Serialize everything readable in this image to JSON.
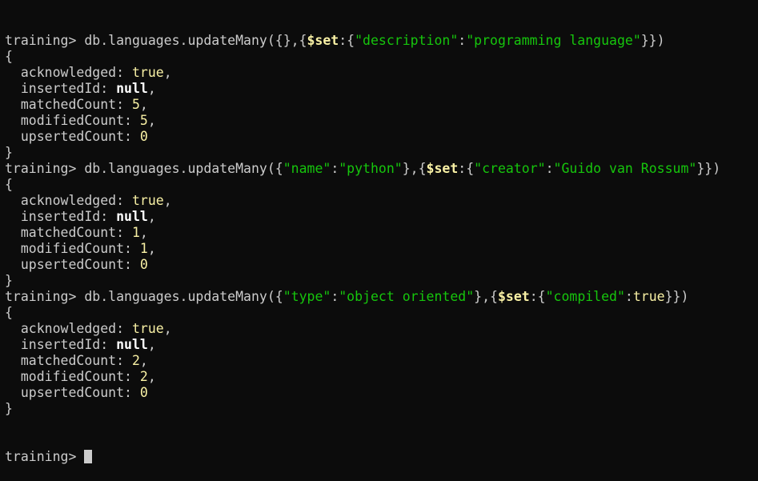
{
  "terminal": {
    "lines": [
      [
        {
          "t": "training> ",
          "c": "default"
        },
        {
          "t": "db.languages.updateMany({},{",
          "c": "default"
        },
        {
          "t": "$set",
          "c": "op"
        },
        {
          "t": ":{",
          "c": "default"
        },
        {
          "t": "\"description\"",
          "c": "string"
        },
        {
          "t": ":",
          "c": "default"
        },
        {
          "t": "\"programming language\"",
          "c": "string"
        },
        {
          "t": "}})",
          "c": "default"
        }
      ],
      [
        {
          "t": "{",
          "c": "default"
        }
      ],
      [
        {
          "t": "  acknowledged: ",
          "c": "default"
        },
        {
          "t": "true",
          "c": "bool"
        },
        {
          "t": ",",
          "c": "default"
        }
      ],
      [
        {
          "t": "  insertedId: ",
          "c": "default"
        },
        {
          "t": "null",
          "c": "null"
        },
        {
          "t": ",",
          "c": "default"
        }
      ],
      [
        {
          "t": "  matchedCount: ",
          "c": "default"
        },
        {
          "t": "5",
          "c": "num"
        },
        {
          "t": ",",
          "c": "default"
        }
      ],
      [
        {
          "t": "  modifiedCount: ",
          "c": "default"
        },
        {
          "t": "5",
          "c": "num"
        },
        {
          "t": ",",
          "c": "default"
        }
      ],
      [
        {
          "t": "  upsertedCount: ",
          "c": "default"
        },
        {
          "t": "0",
          "c": "num"
        }
      ],
      [
        {
          "t": "}",
          "c": "default"
        }
      ],
      [
        {
          "t": "training> ",
          "c": "default"
        },
        {
          "t": "db.languages.updateMany({",
          "c": "default"
        },
        {
          "t": "\"name\"",
          "c": "string"
        },
        {
          "t": ":",
          "c": "default"
        },
        {
          "t": "\"python\"",
          "c": "string"
        },
        {
          "t": "},{",
          "c": "default"
        },
        {
          "t": "$set",
          "c": "op"
        },
        {
          "t": ":{",
          "c": "default"
        },
        {
          "t": "\"creator\"",
          "c": "string"
        },
        {
          "t": ":",
          "c": "default"
        },
        {
          "t": "\"Guido van Rossum\"",
          "c": "string"
        },
        {
          "t": "}})",
          "c": "default"
        }
      ],
      [
        {
          "t": "{",
          "c": "default"
        }
      ],
      [
        {
          "t": "  acknowledged: ",
          "c": "default"
        },
        {
          "t": "true",
          "c": "bool"
        },
        {
          "t": ",",
          "c": "default"
        }
      ],
      [
        {
          "t": "  insertedId: ",
          "c": "default"
        },
        {
          "t": "null",
          "c": "null"
        },
        {
          "t": ",",
          "c": "default"
        }
      ],
      [
        {
          "t": "  matchedCount: ",
          "c": "default"
        },
        {
          "t": "1",
          "c": "num"
        },
        {
          "t": ",",
          "c": "default"
        }
      ],
      [
        {
          "t": "  modifiedCount: ",
          "c": "default"
        },
        {
          "t": "1",
          "c": "num"
        },
        {
          "t": ",",
          "c": "default"
        }
      ],
      [
        {
          "t": "  upsertedCount: ",
          "c": "default"
        },
        {
          "t": "0",
          "c": "num"
        }
      ],
      [
        {
          "t": "}",
          "c": "default"
        }
      ],
      [
        {
          "t": "training> ",
          "c": "default"
        },
        {
          "t": "db.languages.updateMany({",
          "c": "default"
        },
        {
          "t": "\"type\"",
          "c": "string"
        },
        {
          "t": ":",
          "c": "default"
        },
        {
          "t": "\"object oriented\"",
          "c": "string"
        },
        {
          "t": "},{",
          "c": "default"
        },
        {
          "t": "$set",
          "c": "op"
        },
        {
          "t": ":{",
          "c": "default"
        },
        {
          "t": "\"compiled\"",
          "c": "string"
        },
        {
          "t": ":",
          "c": "default"
        },
        {
          "t": "true",
          "c": "bool"
        },
        {
          "t": "}})",
          "c": "default"
        }
      ],
      [
        {
          "t": "{",
          "c": "default"
        }
      ],
      [
        {
          "t": "  acknowledged: ",
          "c": "default"
        },
        {
          "t": "true",
          "c": "bool"
        },
        {
          "t": ",",
          "c": "default"
        }
      ],
      [
        {
          "t": "  insertedId: ",
          "c": "default"
        },
        {
          "t": "null",
          "c": "null"
        },
        {
          "t": ",",
          "c": "default"
        }
      ],
      [
        {
          "t": "  matchedCount: ",
          "c": "default"
        },
        {
          "t": "2",
          "c": "num"
        },
        {
          "t": ",",
          "c": "default"
        }
      ],
      [
        {
          "t": "  modifiedCount: ",
          "c": "default"
        },
        {
          "t": "2",
          "c": "num"
        },
        {
          "t": ",",
          "c": "default"
        }
      ],
      [
        {
          "t": "  upsertedCount: ",
          "c": "default"
        },
        {
          "t": "0",
          "c": "num"
        }
      ],
      [
        {
          "t": "}",
          "c": "default"
        }
      ]
    ],
    "prompt": "training> ",
    "colors": {
      "background": "#0c0c0c",
      "default": "#cccccc",
      "string": "#16c60c",
      "keyword": "#f9f1a5",
      "null": "#ffffff"
    }
  }
}
